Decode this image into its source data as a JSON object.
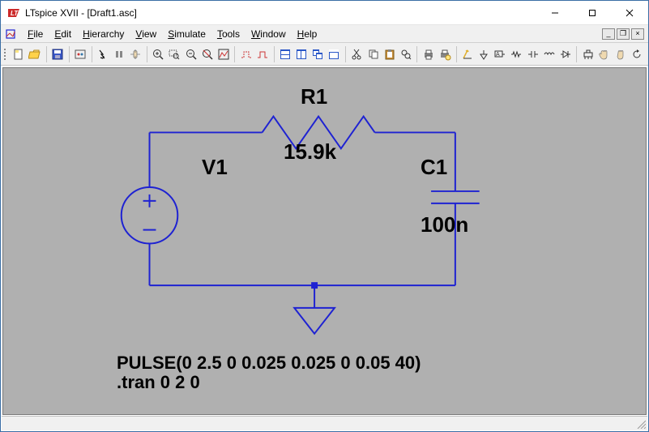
{
  "window": {
    "title": "LTspice XVII - [Draft1.asc]"
  },
  "menu": {
    "items": [
      {
        "label": "File",
        "ul": 0
      },
      {
        "label": "Edit",
        "ul": 0
      },
      {
        "label": "Hierarchy",
        "ul": 0
      },
      {
        "label": "View",
        "ul": 0
      },
      {
        "label": "Simulate",
        "ul": 0
      },
      {
        "label": "Tools",
        "ul": 0
      },
      {
        "label": "Window",
        "ul": 0
      },
      {
        "label": "Help",
        "ul": 0
      }
    ]
  },
  "toolbar": {
    "groups": [
      [
        "new-schematic-icon",
        "open-icon"
      ],
      [
        "save-icon"
      ],
      [
        "control-panel-icon"
      ],
      [
        "run-icon",
        "halt-icon",
        "pan-icon"
      ],
      [
        "zoom-in-icon",
        "zoom-area-icon",
        "zoom-out-icon",
        "zoom-fit-icon",
        "autorange-icon"
      ],
      [
        "pick-net-icon",
        "label-net-icon"
      ],
      [
        "tile-vert-icon",
        "tile-horiz-icon",
        "cascade-icon",
        "close-all-icon"
      ],
      [
        "cut-icon",
        "copy-icon",
        "paste-icon",
        "find-icon"
      ],
      [
        "print-icon",
        "print-setup-icon"
      ],
      [
        "draw-wire-icon",
        "ground-icon",
        "label-icon",
        "resistor-icon",
        "capacitor-icon",
        "inductor-icon",
        "diode-icon"
      ],
      [
        "component-icon",
        "move-icon",
        "drag-icon",
        "rotate-icon"
      ]
    ]
  },
  "schematic": {
    "R1": {
      "name": "R1",
      "value": "15.9k"
    },
    "V1": {
      "name": "V1"
    },
    "C1": {
      "name": "C1",
      "value": "100n"
    },
    "pulse_directive": "PULSE(0 2.5 0 0.025 0.025 0 0.05 40)",
    "tran_directive": ".tran 0 2 0"
  },
  "colors": {
    "wire_blue": "#1e22d2",
    "canvas_gray": "#b0b0b0",
    "logo_red": "#cc2a2a"
  }
}
